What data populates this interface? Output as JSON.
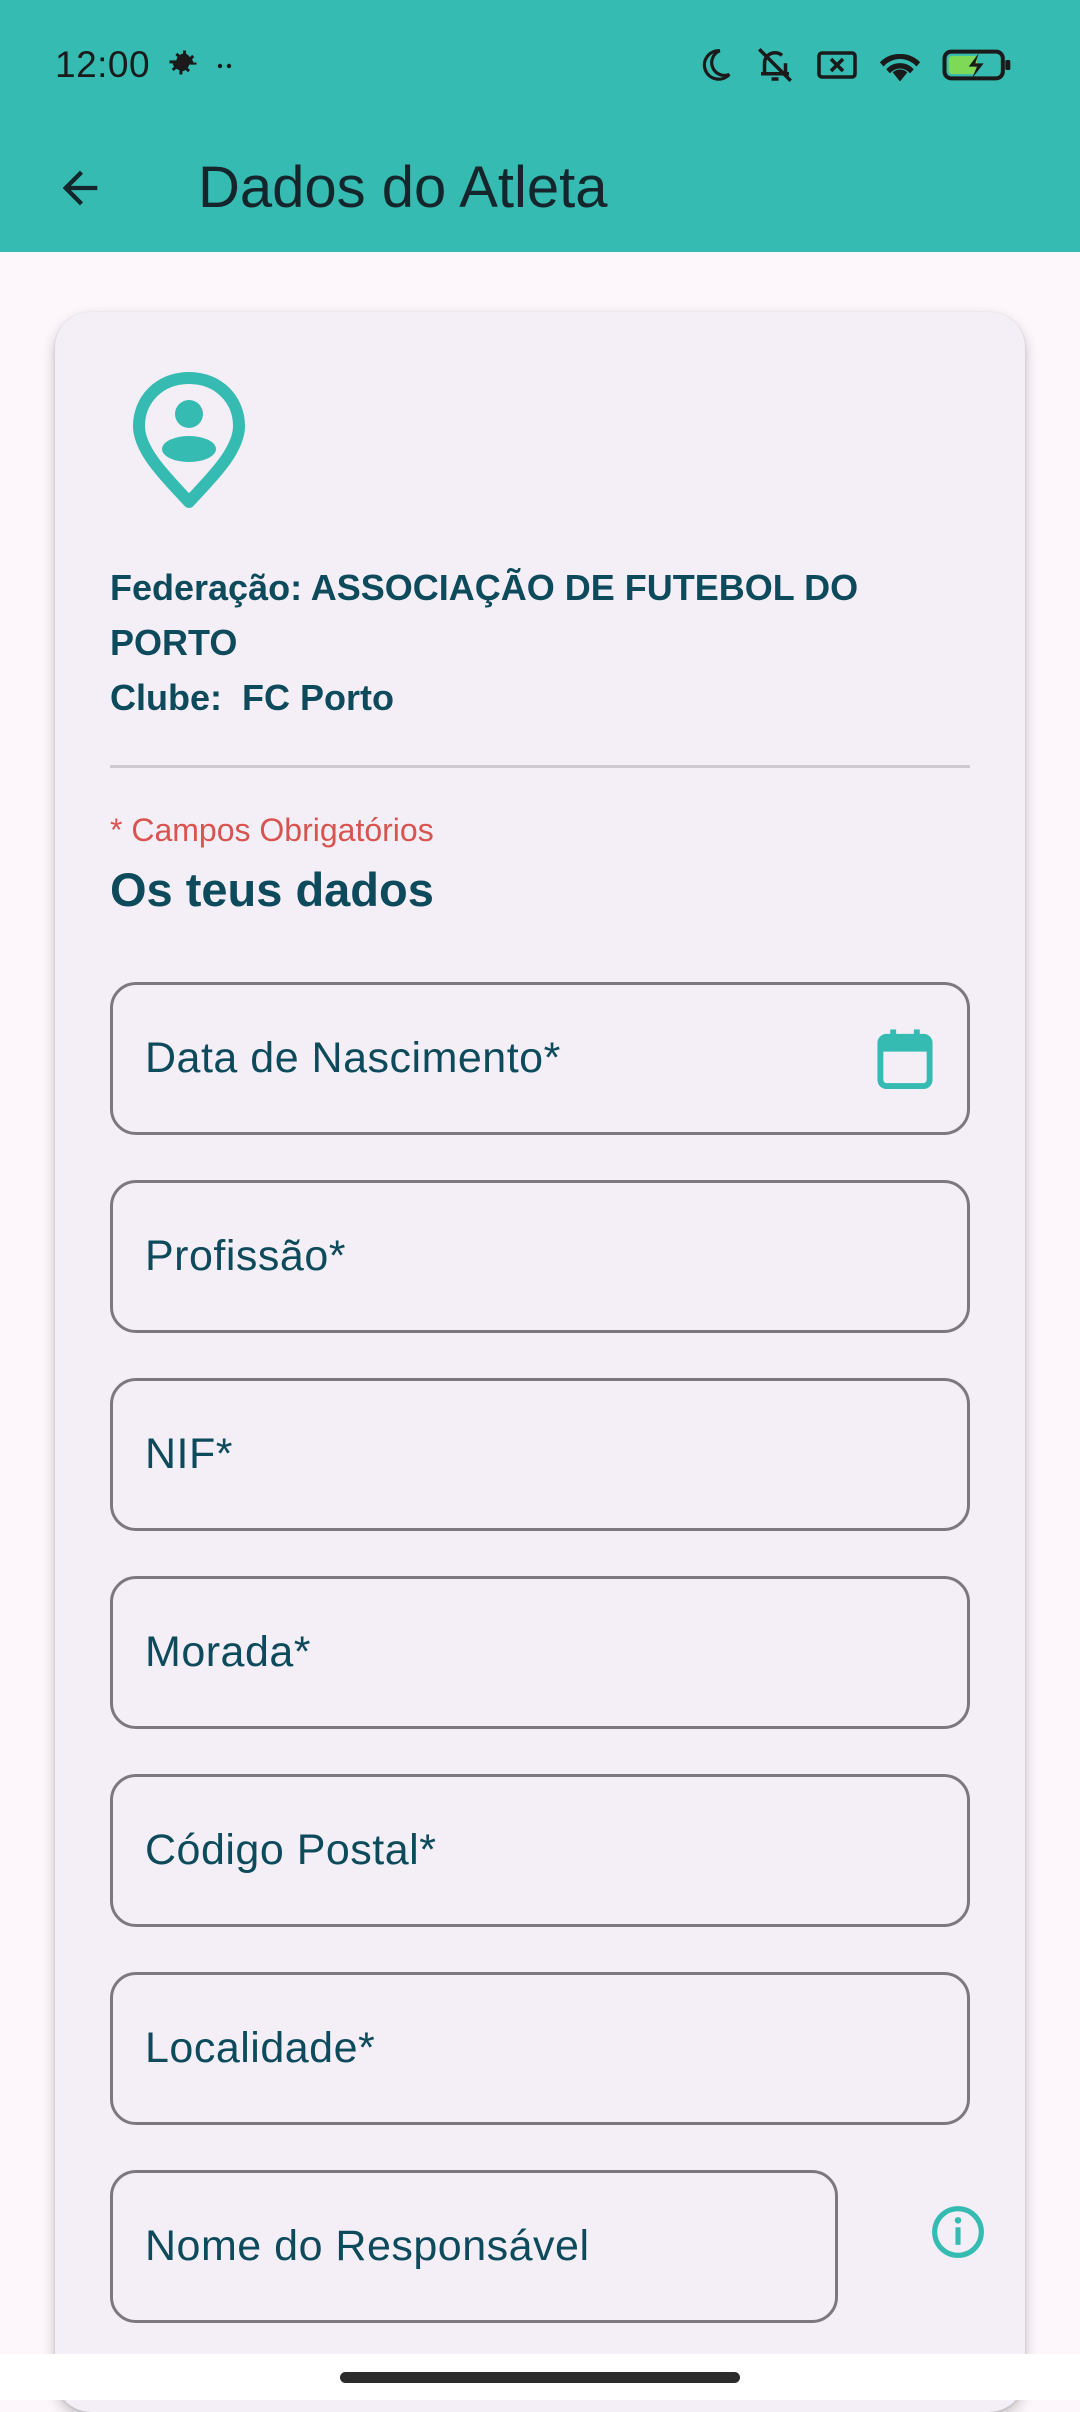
{
  "status_bar": {
    "time": "12:00",
    "icons": [
      "settings-icon",
      "more-dots-icon",
      "moon-icon",
      "mute-icon",
      "no-sim-icon",
      "wifi-icon",
      "battery-charging-icon"
    ]
  },
  "toolbar": {
    "title": "Dados do Atleta",
    "back_icon": "arrow-back-icon"
  },
  "card": {
    "federation_line": "Federação: ASSOCIAÇÃO DE FUTEBOL DO PORTO",
    "club_line": "Clube:  FC Porto",
    "required_note": "* Campos Obrigatórios",
    "section_title": "Os teus dados"
  },
  "form": {
    "birth_date": {
      "label": "Data de Nascimento*",
      "value": ""
    },
    "profession": {
      "label": "Profissão*",
      "value": ""
    },
    "nif": {
      "label": "NIF*",
      "value": ""
    },
    "address": {
      "label": "Morada*",
      "value": ""
    },
    "postal_code": {
      "label": "Código Postal*",
      "value": ""
    },
    "locality": {
      "label": "Localidade*",
      "value": ""
    },
    "guardian_name": {
      "label": "Nome do Responsável",
      "value": ""
    }
  },
  "colors": {
    "accent": "#35bbb1",
    "text_dark": "#0d4a5c",
    "required": "#d9534f",
    "card_bg": "#f4eff6"
  }
}
